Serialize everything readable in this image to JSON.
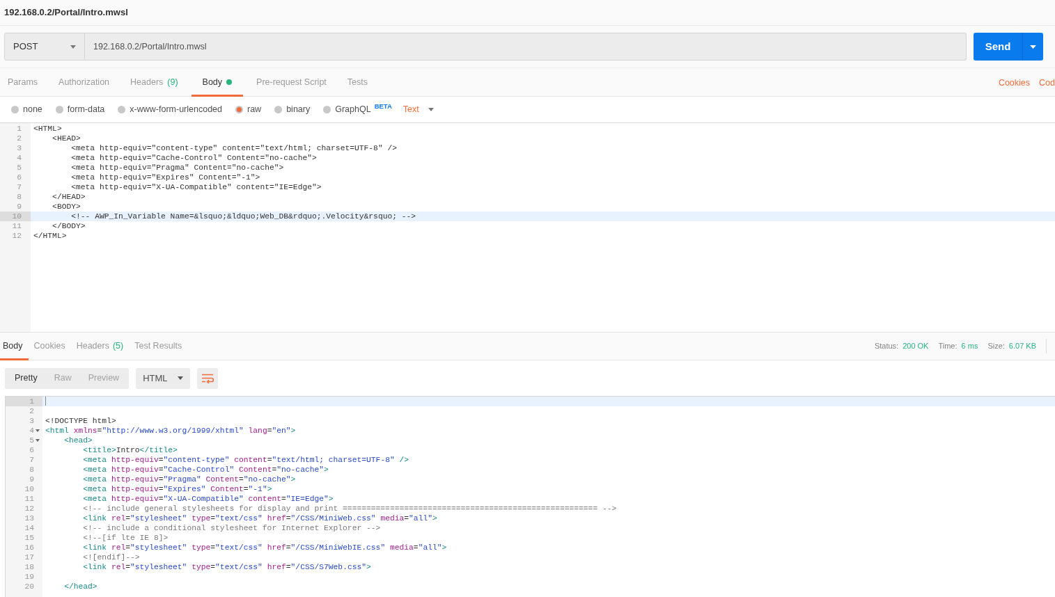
{
  "window": {
    "title": "192.168.0.2/Portal/Intro.mwsl"
  },
  "request": {
    "method": "POST",
    "url": "192.168.0.2/Portal/Intro.mwsl",
    "send_label": "Send"
  },
  "request_tabs": [
    {
      "label": "Params",
      "selected": false
    },
    {
      "label": "Authorization",
      "selected": false
    },
    {
      "label": "Headers",
      "count": "(9)",
      "selected": false
    },
    {
      "label": "Body",
      "dot": true,
      "selected": true
    },
    {
      "label": "Pre-request Script",
      "selected": false
    },
    {
      "label": "Tests",
      "selected": false
    }
  ],
  "request_links": [
    "Cookies",
    "Cod"
  ],
  "body_modes": [
    {
      "label": "none",
      "selected": false
    },
    {
      "label": "form-data",
      "selected": false
    },
    {
      "label": "x-www-form-urlencoded",
      "selected": false
    },
    {
      "label": "raw",
      "selected": true
    },
    {
      "label": "binary",
      "selected": false
    },
    {
      "label": "GraphQL",
      "badge": "BETA",
      "selected": false
    }
  ],
  "body_format": "Text",
  "request_body": [
    {
      "line": "1",
      "text": "<HTML>",
      "current": false
    },
    {
      "line": "2",
      "text": "    <HEAD>",
      "current": false
    },
    {
      "line": "3",
      "text": "        <meta http-equiv=\"content-type\" content=\"text/html; charset=UTF-8\" />",
      "current": false
    },
    {
      "line": "4",
      "text": "        <meta http-equiv=\"Cache-Control\" Content=\"no-cache\">",
      "current": false
    },
    {
      "line": "5",
      "text": "        <meta http-equiv=\"Pragma\" Content=\"no-cache\">",
      "current": false
    },
    {
      "line": "6",
      "text": "        <meta http-equiv=\"Expires\" Content=\"-1\">",
      "current": false
    },
    {
      "line": "7",
      "text": "        <meta http-equiv=\"X-UA-Compatible\" content=\"IE=Edge\">",
      "current": false
    },
    {
      "line": "8",
      "text": "    </HEAD>",
      "current": false
    },
    {
      "line": "9",
      "text": "    <BODY>",
      "current": false
    },
    {
      "line": "10",
      "text": "        <!-- AWP_In_Variable Name=&lsquo;&ldquo;Web_DB&rdquo;.Velocity&rsquo; -->",
      "current": true
    },
    {
      "line": "11",
      "text": "    </BODY>",
      "current": false
    },
    {
      "line": "12",
      "text": "</HTML>",
      "current": false
    }
  ],
  "response_tabs": [
    {
      "label": "Body",
      "selected": true
    },
    {
      "label": "Cookies",
      "selected": false
    },
    {
      "label": "Headers",
      "count": "(5)",
      "selected": false
    },
    {
      "label": "Test Results",
      "selected": false
    }
  ],
  "response_status": [
    {
      "label": "Status:",
      "value": "200 OK"
    },
    {
      "label": "Time:",
      "value": "6 ms"
    },
    {
      "label": "Size:",
      "value": "6.07 KB"
    }
  ],
  "view_modes": [
    {
      "label": "Pretty",
      "selected": true
    },
    {
      "label": "Raw",
      "selected": false
    },
    {
      "label": "Preview",
      "selected": false
    }
  ],
  "response_format": "HTML",
  "response_body": [
    {
      "line": "1",
      "foldable": false,
      "current": true
    },
    {
      "line": "2",
      "foldable": false,
      "current": false
    },
    {
      "line": "3",
      "text": "<!DOCTYPE html>",
      "foldable": false,
      "current": false
    },
    {
      "line": "4",
      "text": "<html xmlns=\"http://www.w3.org/1999/xhtml\" lang=\"en\">",
      "foldable": true,
      "current": false
    },
    {
      "line": "5",
      "text": "    <head>",
      "foldable": true,
      "current": false
    },
    {
      "line": "6",
      "text": "        <title>Intro</title>",
      "foldable": false,
      "current": false
    },
    {
      "line": "7",
      "text": "        <meta http-equiv=\"content-type\" content=\"text/html; charset=UTF-8\" />",
      "foldable": false,
      "current": false
    },
    {
      "line": "8",
      "text": "        <meta http-equiv=\"Cache-Control\" Content=\"no-cache\">",
      "foldable": false,
      "current": false
    },
    {
      "line": "9",
      "text": "        <meta http-equiv=\"Pragma\" Content=\"no-cache\">",
      "foldable": false,
      "current": false
    },
    {
      "line": "10",
      "text": "        <meta http-equiv=\"Expires\" Content=\"-1\">",
      "foldable": false,
      "current": false
    },
    {
      "line": "11",
      "text": "        <meta http-equiv=\"X-UA-Compatible\" content=\"IE=Edge\">",
      "foldable": false,
      "current": false
    },
    {
      "line": "12",
      "text": "        <!-- include general stylesheets for display and print ====================================================== -->",
      "foldable": false,
      "current": false
    },
    {
      "line": "13",
      "text": "        <link rel=\"stylesheet\" type=\"text/css\" href=\"/CSS/MiniWeb.css\" media=\"all\">",
      "foldable": false,
      "current": false
    },
    {
      "line": "14",
      "text": "        <!-- include a conditional stylesheet for Internet Explorer -->",
      "foldable": false,
      "current": false
    },
    {
      "line": "15",
      "text": "        <!--[if lte IE 8]>",
      "foldable": false,
      "current": false
    },
    {
      "line": "16",
      "text": "        <link rel=\"stylesheet\" type=\"text/css\" href=\"/CSS/MiniWebIE.css\" media=\"all\">",
      "foldable": false,
      "current": false
    },
    {
      "line": "17",
      "text": "        <![endif]-->",
      "foldable": false,
      "current": false
    },
    {
      "line": "18",
      "text": "        <link rel=\"stylesheet\" type=\"text/css\" href=\"/CSS/S7Web.css\">",
      "foldable": false,
      "current": false
    },
    {
      "line": "19",
      "foldable": false,
      "current": false
    },
    {
      "line": "20",
      "text": "    </head>",
      "foldable": false,
      "current": false
    }
  ]
}
